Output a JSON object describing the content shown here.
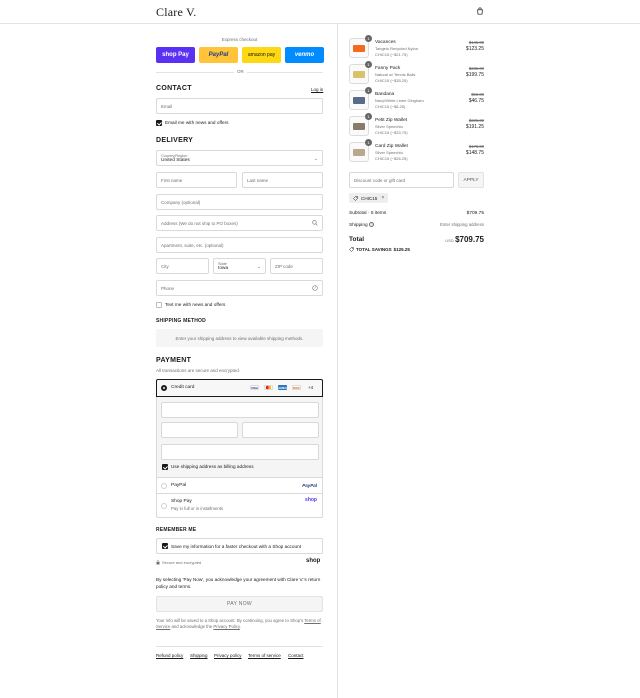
{
  "header": {
    "logo": "Clare V.",
    "cart_icon": "shopping-bag-icon"
  },
  "express": {
    "label": "Express checkout",
    "buttons": [
      "shop Pay",
      "PayPal",
      "amazon pay",
      "venmo"
    ],
    "or": "OR"
  },
  "contact": {
    "title": "CONTACT",
    "login": "Log in",
    "email_placeholder": "Email",
    "news_label": "Email me with news and offers"
  },
  "delivery": {
    "title": "DELIVERY",
    "country_label": "Country/Region",
    "country_value": "United States",
    "first_name": "First name",
    "last_name": "Last name",
    "company": "Company (optional)",
    "address": "Address (We do not ship to PO boxes)",
    "apartment": "Apartment, suite, etc. (optional)",
    "city": "City",
    "state_label": "State",
    "state_value": "Iowa",
    "zip": "ZIP code",
    "phone": "Phone",
    "text_news": "Text me with news and offers"
  },
  "shipping": {
    "title": "SHIPPING METHOD",
    "note": "Enter your shipping address to view available shipping methods."
  },
  "payment": {
    "title": "PAYMENT",
    "subtitle": "All transactions are secure and encrypted.",
    "credit_card": "Credit card",
    "card_brands": [
      "VISA",
      "MC",
      "AMEX",
      "DISC"
    ],
    "more_brands": "+4",
    "billing_same": "Use shipping address as billing address",
    "paypal": "PayPal",
    "paypal_logo": "PayPal",
    "shop_pay": "Shop Pay",
    "shop_pay_sub": "Pay in full or in installments",
    "shop_logo": "shop"
  },
  "remember": {
    "title": "REMEMBER ME",
    "save_info": "Save my information for a faster checkout with a Shop account",
    "secure": "Secure and encrypted",
    "shop_logo": "shop"
  },
  "legal": {
    "agreement": "By selecting 'Pay Now', you acknowledge your agreement with Clare V.'s return policy and terms.",
    "pay_now": "PAY NOW",
    "shop_note_1": "Your info will be saved to a Shop account. By continuing, you agree to Shop's",
    "terms_link": "Terms of Service",
    "shop_note_2": "and acknowledge the",
    "privacy_link": "Privacy Policy",
    "period": "."
  },
  "footer": {
    "links": [
      "Refund policy",
      "Shipping",
      "Privacy policy",
      "Terms of service",
      "Contact"
    ]
  },
  "cart": {
    "items": [
      {
        "qty": "1",
        "name": "Vacances",
        "variant": "Tangelo Recycled Nylon",
        "discount": "CHIC15 (−$21.75)",
        "old_price": "$145.00",
        "price": "$123.25",
        "color": "#f26a1b"
      },
      {
        "qty": "1",
        "name": "Fanny Pack",
        "variant": "Natural w/ Tennis Balls",
        "discount": "CHIC15 (−$35.25)",
        "old_price": "$235.00",
        "price": "$199.75",
        "color": "#d9c36a"
      },
      {
        "qty": "1",
        "name": "Bandana",
        "variant": "Navy/White Linen Gingham",
        "discount": "CHIC15 (−$8.25)",
        "old_price": "$55.00",
        "price": "$46.75",
        "color": "#5a6a8c"
      },
      {
        "qty": "1",
        "name": "Petit Zip Wallet",
        "variant": "Silver Speechio",
        "discount": "CHIC15 (−$33.75)",
        "old_price": "$225.00",
        "price": "$191.25",
        "color": "#8a7a6a"
      },
      {
        "qty": "1",
        "name": "Card Zip Wallet",
        "variant": "Silver Speechio",
        "discount": "CHIC15 (−$26.25)",
        "old_price": "$175.00",
        "price": "$148.75",
        "color": "#b8a890"
      }
    ],
    "discount_placeholder": "Discount code or gift card",
    "apply": "APPLY",
    "applied_code": "CHIC15",
    "subtotal_label": "Subtotal · 5 items",
    "subtotal": "$709.75",
    "shipping_label": "Shipping",
    "shipping_value": "Enter shipping address",
    "total_label": "Total",
    "currency": "USD",
    "total": "$709.75",
    "savings_label": "TOTAL SAVINGS",
    "savings": "$125.25"
  }
}
